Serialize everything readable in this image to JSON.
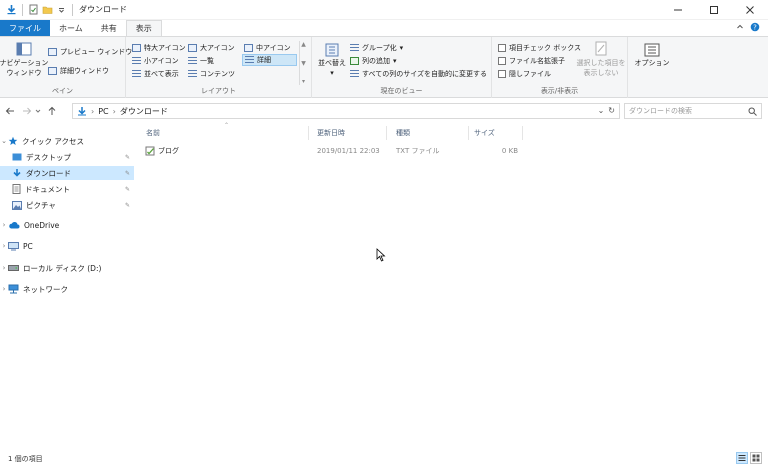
{
  "window": {
    "title": "ダウンロード",
    "controls": {
      "minimize": "—",
      "maximize": "☐",
      "close": "✕"
    }
  },
  "tabs": [
    {
      "label": "ファイル"
    },
    {
      "label": "ホーム"
    },
    {
      "label": "共有"
    },
    {
      "label": "表示"
    }
  ],
  "ribbon": {
    "pane": {
      "nav_pane_line1": "ナビゲーション",
      "nav_pane_line2": "ウィンドウ",
      "preview_pane": "プレビュー ウィンドウ",
      "details_pane": "詳細ウィンドウ",
      "label": "ペイン"
    },
    "layout": {
      "extra_large": "特大アイコン",
      "large": "大アイコン",
      "medium": "中アイコン",
      "small": "小アイコン",
      "list": "一覧",
      "details": "詳細",
      "tiles": "並べて表示",
      "content": "コンテンツ",
      "label": "レイアウト"
    },
    "current_view": {
      "sort_by": "並べ替え",
      "group_by": "グループ化",
      "add_columns": "列の追加",
      "size_all_columns": "すべての列のサイズを自動的に変更する",
      "label": "現在のビュー"
    },
    "show_hide": {
      "item_checkboxes": "項目チェック ボックス",
      "file_extensions": "ファイル名拡張子",
      "hidden_items": "隠しファイル",
      "hide_selected_line1": "選択した項目を",
      "hide_selected_line2": "表示しない",
      "label": "表示/非表示"
    },
    "options": "オプション"
  },
  "address": {
    "path": [
      "PC",
      "ダウンロード"
    ],
    "search_placeholder": "ダウンロードの検索"
  },
  "nav": {
    "quick_access": "クイック アクセス",
    "desktop": "デスクトップ",
    "downloads": "ダウンロード",
    "documents": "ドキュメント",
    "pictures": "ピクチャ",
    "onedrive": "OneDrive",
    "pc": "PC",
    "local_disk": "ローカル ディスク (D:)",
    "network": "ネットワーク"
  },
  "columns": {
    "name": "名前",
    "modified": "更新日時",
    "type": "種類",
    "size": "サイズ"
  },
  "files": [
    {
      "name": "ブログ",
      "modified": "2019/01/11 22:03",
      "type": "TXT ファイル",
      "size": "0 KB"
    }
  ],
  "status": {
    "count": "1 個の項目"
  },
  "colors": {
    "accent": "#1979ca",
    "selected": "#cce8ff",
    "ribbon_bg": "#f5f6f7"
  }
}
